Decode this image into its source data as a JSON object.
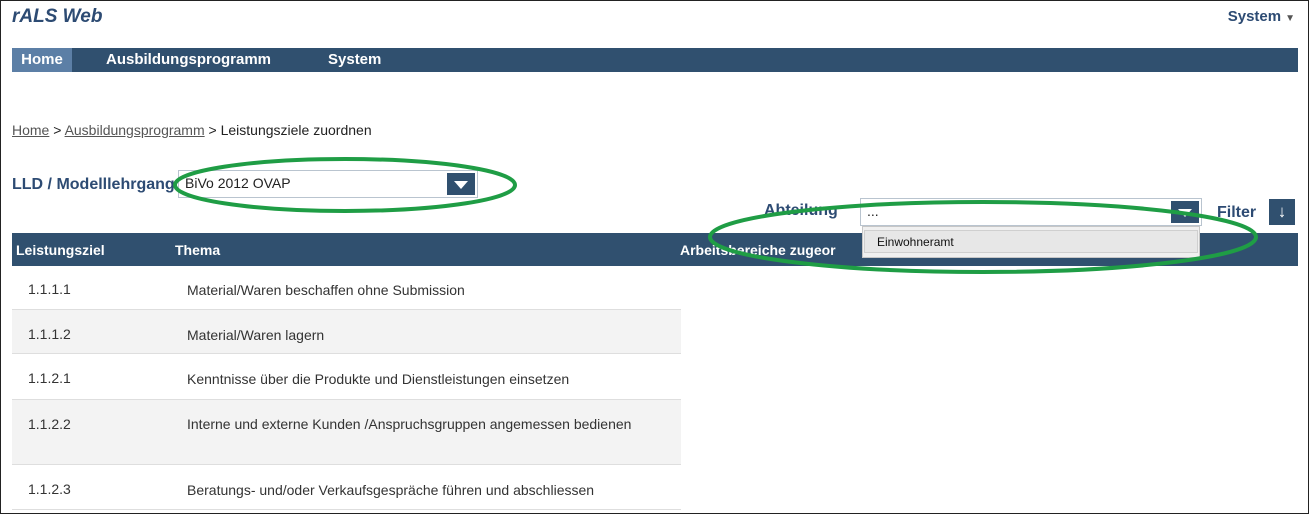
{
  "app": {
    "title": "rALS Web",
    "system_menu": "System"
  },
  "nav": {
    "items": [
      "Home",
      "Ausbildungsprogramm",
      "System"
    ],
    "active": "Home"
  },
  "breadcrumb": {
    "home": "Home",
    "sep": ">",
    "programm": "Ausbildungsprogramm",
    "current": "Leistungsziele zuordnen"
  },
  "form": {
    "lld_label": "LLD / Modelllehrgang:",
    "lld_value": "BiVo 2012 OVAP",
    "abteilung_label": "Abteilung",
    "abteilung_value": "...",
    "abteilung_options": [
      "Einwohneramt"
    ],
    "filter_label": "Filter"
  },
  "table": {
    "headers": [
      "Leistungsziel",
      "Thema",
      "Arbeitsbereiche zugeor"
    ],
    "rows": [
      {
        "id": "1.1.1.1",
        "topic": "Material/Waren beschaffen ohne Submission"
      },
      {
        "id": "1.1.1.2",
        "topic": "Material/Waren lagern"
      },
      {
        "id": "1.1.2.1",
        "topic": "Kenntnisse über die Produkte und Dienstleistungen einsetzen"
      },
      {
        "id": "1.1.2.2",
        "topic": "Interne und externe Kunden /Anspruchsgruppen angemessen bedienen"
      },
      {
        "id": "1.1.2.3",
        "topic": "Beratungs- und/oder Verkaufsgespräche führen und abschliessen"
      }
    ]
  },
  "colors": {
    "brand": "#30506f",
    "nav_active": "#5c7fa6",
    "annotation": "#1f9d45"
  }
}
